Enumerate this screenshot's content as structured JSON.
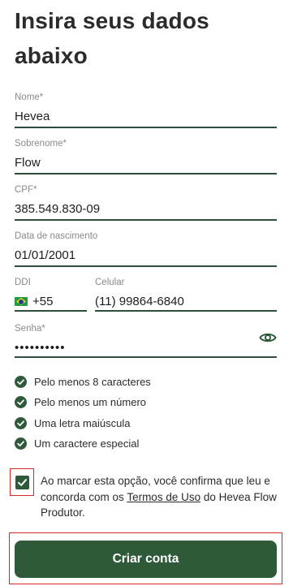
{
  "page": {
    "title": "Insira seus dados abaixo"
  },
  "form": {
    "nome": {
      "label": "Nome*",
      "value": "Hevea"
    },
    "sobrenome": {
      "label": "Sobrenome*",
      "value": "Flow"
    },
    "cpf": {
      "label": "CPF*",
      "value": "385.549.830-09"
    },
    "nascimento": {
      "label": "Data de nascimento",
      "value": "01/01/2001"
    },
    "ddi": {
      "label": "DDI",
      "value": "+55",
      "flag_icon": "brazil-flag-icon"
    },
    "celular": {
      "label": "Celular",
      "value": "(11) 99864-6840"
    },
    "senha": {
      "label": "Senha*",
      "value": "••••••••••",
      "toggle_icon": "eye-icon"
    }
  },
  "password_rules": [
    {
      "text": "Pelo menos 8 caracteres",
      "met": true
    },
    {
      "text": "Pelo menos um número",
      "met": true
    },
    {
      "text": "Uma letra maiúscula",
      "met": true
    },
    {
      "text": "Um caractere especial",
      "met": true
    }
  ],
  "terms": {
    "checked": true,
    "text_before": "Ao marcar esta opção, você confirma que leu e concorda com os ",
    "link": "Termos de Uso",
    "text_after": " do Hevea Flow Produtor."
  },
  "submit": {
    "label": "Criar conta"
  },
  "colors": {
    "primary": "#2e5a3a",
    "underline": "#2e4d3a",
    "highlight": "#d62828"
  }
}
